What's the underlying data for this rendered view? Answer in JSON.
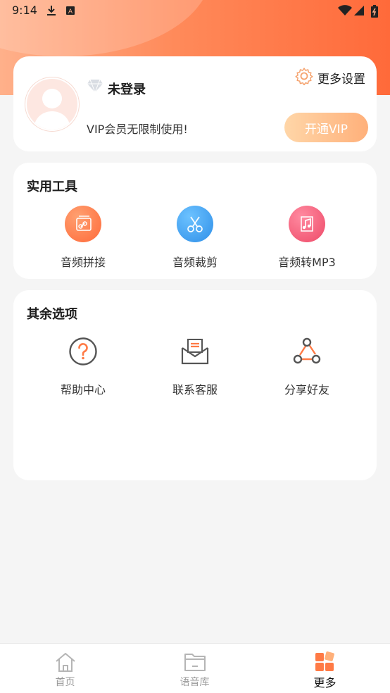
{
  "status_bar": {
    "time": "9:14"
  },
  "profile": {
    "login_status": "未登录",
    "vip_desc": "VIP会员无限制使用!",
    "settings_label": "更多设置",
    "open_vip_label": "开通VIP"
  },
  "tools": {
    "title": "实用工具",
    "items": [
      {
        "label": "音频拼接",
        "icon": "link-icon",
        "color": "#ff7a45"
      },
      {
        "label": "音频裁剪",
        "icon": "scissors-icon",
        "color": "#2f9bf0"
      },
      {
        "label": "音频转MP3",
        "icon": "music-note-icon",
        "color": "#f0506e"
      }
    ]
  },
  "others": {
    "title": "其余选项",
    "items": [
      {
        "label": "帮助中心",
        "icon": "help-icon"
      },
      {
        "label": "联系客服",
        "icon": "mail-icon"
      },
      {
        "label": "分享好友",
        "icon": "share-icon"
      }
    ]
  },
  "bottom_nav": {
    "items": [
      {
        "label": "首页",
        "icon": "home-icon"
      },
      {
        "label": "语音库",
        "icon": "folder-icon"
      },
      {
        "label": "更多",
        "icon": "more-grid-icon",
        "active": true
      }
    ]
  },
  "colors": {
    "accent": "#ff6a3a",
    "vip_button": "#ffb07a"
  }
}
